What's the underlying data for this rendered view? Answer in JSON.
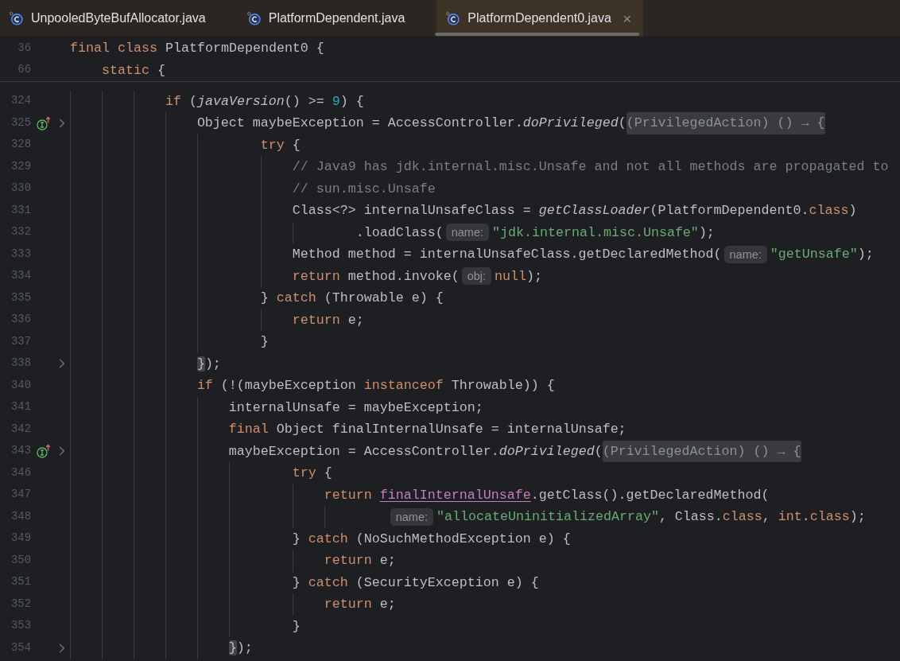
{
  "tabs": [
    {
      "label": "UnpooledByteBufAllocator.java",
      "selected": false
    },
    {
      "label": "PlatformDependent.java",
      "selected": false
    },
    {
      "label": "PlatformDependent0.java",
      "selected": true,
      "close": "×"
    }
  ],
  "sticky_lines": [
    {
      "number": "36",
      "code": [
        {
          "kind": "keyword",
          "text": "final class"
        },
        {
          "kind": "plain",
          "text": " PlatformDependent0 {"
        }
      ]
    },
    {
      "number": "66",
      "code": [
        {
          "kind": "keyword",
          "text": "    static"
        },
        {
          "kind": "plain",
          "text": " {"
        }
      ]
    }
  ],
  "lines": [
    {
      "number": "324",
      "code": [
        {
          "kind": "keyword",
          "text": "            if"
        },
        {
          "kind": "plain",
          "text": " ("
        },
        {
          "kind": "call",
          "text": "javaVersion"
        },
        {
          "kind": "plain",
          "text": "() >= "
        },
        {
          "kind": "number",
          "text": "9"
        },
        {
          "kind": "plain",
          "text": ") {"
        }
      ]
    },
    {
      "number": "325",
      "implements_marker": true,
      "fold_toggle": true,
      "code": [
        {
          "kind": "plain",
          "text": "                Object maybeException = AccessController."
        },
        {
          "kind": "call",
          "text": "doPrivileged"
        },
        {
          "kind": "plain",
          "text": "("
        },
        {
          "kind": "folded",
          "text": "(PrivilegedAction) () → {"
        }
      ]
    },
    {
      "number": "328",
      "code": [
        {
          "kind": "keyword",
          "text": "                        try"
        },
        {
          "kind": "plain",
          "text": " {"
        }
      ]
    },
    {
      "number": "329",
      "code": [
        {
          "kind": "comment",
          "text": "                            // Java9 has jdk.internal.misc.Unsafe and not all methods are propagated to"
        }
      ]
    },
    {
      "number": "330",
      "code": [
        {
          "kind": "comment",
          "text": "                            // sun.misc.Unsafe"
        }
      ]
    },
    {
      "number": "331",
      "code": [
        {
          "kind": "plain",
          "text": "                            Class<?> internalUnsafeClass = "
        },
        {
          "kind": "call",
          "text": "getClassLoader"
        },
        {
          "kind": "plain",
          "text": "(PlatformDependent0."
        },
        {
          "kind": "keyword",
          "text": "class"
        },
        {
          "kind": "plain",
          "text": ")"
        }
      ]
    },
    {
      "number": "332",
      "code": [
        {
          "kind": "plain",
          "text": "                                    .loadClass("
        },
        {
          "kind": "hint",
          "text": "name:"
        },
        {
          "kind": "string",
          "text": "\"jdk.internal.misc.Unsafe\""
        },
        {
          "kind": "plain",
          "text": ");"
        }
      ]
    },
    {
      "number": "333",
      "code": [
        {
          "kind": "plain",
          "text": "                            Method method = internalUnsafeClass.getDeclaredMethod("
        },
        {
          "kind": "hint",
          "text": "name:"
        },
        {
          "kind": "string",
          "text": "\"getUnsafe\""
        },
        {
          "kind": "plain",
          "text": ");"
        }
      ]
    },
    {
      "number": "334",
      "code": [
        {
          "kind": "keyword",
          "text": "                            return"
        },
        {
          "kind": "plain",
          "text": " method.invoke("
        },
        {
          "kind": "hint",
          "text": "obj:"
        },
        {
          "kind": "keyword",
          "text": "null"
        },
        {
          "kind": "plain",
          "text": ");"
        }
      ]
    },
    {
      "number": "335",
      "code": [
        {
          "kind": "plain",
          "text": "                        } "
        },
        {
          "kind": "keyword",
          "text": "catch"
        },
        {
          "kind": "plain",
          "text": " (Throwable e) {"
        }
      ]
    },
    {
      "number": "336",
      "code": [
        {
          "kind": "keyword",
          "text": "                            return"
        },
        {
          "kind": "plain",
          "text": " e;"
        }
      ]
    },
    {
      "number": "337",
      "code": [
        {
          "kind": "plain",
          "text": "                        }"
        }
      ]
    },
    {
      "number": "338",
      "fold_toggle": true,
      "code": [
        {
          "kind": "brace",
          "text": "                }"
        },
        {
          "kind": "plain",
          "text": ");"
        }
      ]
    },
    {
      "number": "340",
      "code": [
        {
          "kind": "keyword",
          "text": "                if"
        },
        {
          "kind": "plain",
          "text": " (!(maybeException "
        },
        {
          "kind": "keyword",
          "text": "instanceof"
        },
        {
          "kind": "plain",
          "text": " Throwable)) {"
        }
      ]
    },
    {
      "number": "341",
      "code": [
        {
          "kind": "plain",
          "text": "                    internalUnsafe = maybeException;"
        }
      ]
    },
    {
      "number": "342",
      "code": [
        {
          "kind": "keyword",
          "text": "                    final"
        },
        {
          "kind": "plain",
          "text": " Object finalInternalUnsafe = internalUnsafe;"
        }
      ]
    },
    {
      "number": "343",
      "implements_marker": true,
      "fold_toggle": true,
      "code": [
        {
          "kind": "plain",
          "text": "                    maybeException = AccessController."
        },
        {
          "kind": "call",
          "text": "doPrivileged"
        },
        {
          "kind": "plain",
          "text": "("
        },
        {
          "kind": "folded",
          "text": "(PrivilegedAction) () → {"
        }
      ]
    },
    {
      "number": "346",
      "code": [
        {
          "kind": "keyword",
          "text": "                            try"
        },
        {
          "kind": "plain",
          "text": " {"
        }
      ]
    },
    {
      "number": "347",
      "code": [
        {
          "kind": "keyword",
          "text": "                                return "
        },
        {
          "kind": "captured",
          "text": "finalInternalUnsafe"
        },
        {
          "kind": "plain",
          "text": ".getClass().getDeclaredMethod("
        }
      ]
    },
    {
      "number": "348",
      "code": [
        {
          "kind": "hint",
          "text": "                                        name:"
        },
        {
          "kind": "string",
          "text": "\"allocateUninitializedArray\""
        },
        {
          "kind": "plain",
          "text": ", Class."
        },
        {
          "kind": "keyword",
          "text": "class"
        },
        {
          "kind": "plain",
          "text": ", "
        },
        {
          "kind": "keyword",
          "text": "int"
        },
        {
          "kind": "plain",
          "text": "."
        },
        {
          "kind": "keyword",
          "text": "class"
        },
        {
          "kind": "plain",
          "text": ");"
        }
      ]
    },
    {
      "number": "349",
      "code": [
        {
          "kind": "plain",
          "text": "                            } "
        },
        {
          "kind": "keyword",
          "text": "catch"
        },
        {
          "kind": "plain",
          "text": " (NoSuchMethodException e) {"
        }
      ]
    },
    {
      "number": "350",
      "code": [
        {
          "kind": "keyword",
          "text": "                                return"
        },
        {
          "kind": "plain",
          "text": " e;"
        }
      ]
    },
    {
      "number": "351",
      "code": [
        {
          "kind": "plain",
          "text": "                            } "
        },
        {
          "kind": "keyword",
          "text": "catch"
        },
        {
          "kind": "plain",
          "text": " (SecurityException e) {"
        }
      ]
    },
    {
      "number": "352",
      "code": [
        {
          "kind": "keyword",
          "text": "                                return"
        },
        {
          "kind": "plain",
          "text": " e;"
        }
      ]
    },
    {
      "number": "353",
      "code": [
        {
          "kind": "plain",
          "text": "                            }"
        }
      ]
    },
    {
      "number": "354",
      "fold_toggle": true,
      "code": [
        {
          "kind": "brace",
          "text": "                    }"
        },
        {
          "kind": "plain",
          "text": ");"
        }
      ]
    }
  ]
}
